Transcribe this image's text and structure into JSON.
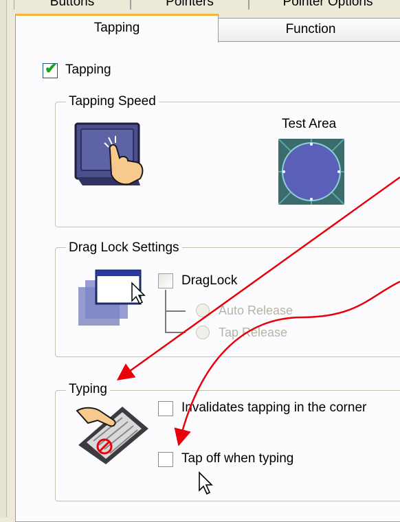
{
  "tabs": {
    "row1": [
      {
        "label": "Buttons"
      },
      {
        "label": "Pointers"
      },
      {
        "label": "Pointer Options"
      }
    ],
    "active": {
      "label": "Tapping"
    },
    "inactive": {
      "label": "Function"
    }
  },
  "tapping": {
    "checkbox_label": "Tapping",
    "checked": true
  },
  "tapping_speed": {
    "legend": "Tapping Speed",
    "test_area_label": "Test Area"
  },
  "drag_lock": {
    "legend": "Drag Lock Settings",
    "checkbox_label": "DragLock",
    "checked": false,
    "options": [
      {
        "label": "Auto Release",
        "enabled": false
      },
      {
        "label": "Tap Release",
        "enabled": false
      }
    ]
  },
  "typing": {
    "legend": "Typing",
    "options": [
      {
        "label": "Invalidates tapping in the corner",
        "checked": false
      },
      {
        "label": "Tap off when typing",
        "checked": false
      }
    ]
  },
  "colors": {
    "annotation_arrow": "#e8000a",
    "tab_highlight": "#f4b43c",
    "checkmark": "#21a121"
  }
}
